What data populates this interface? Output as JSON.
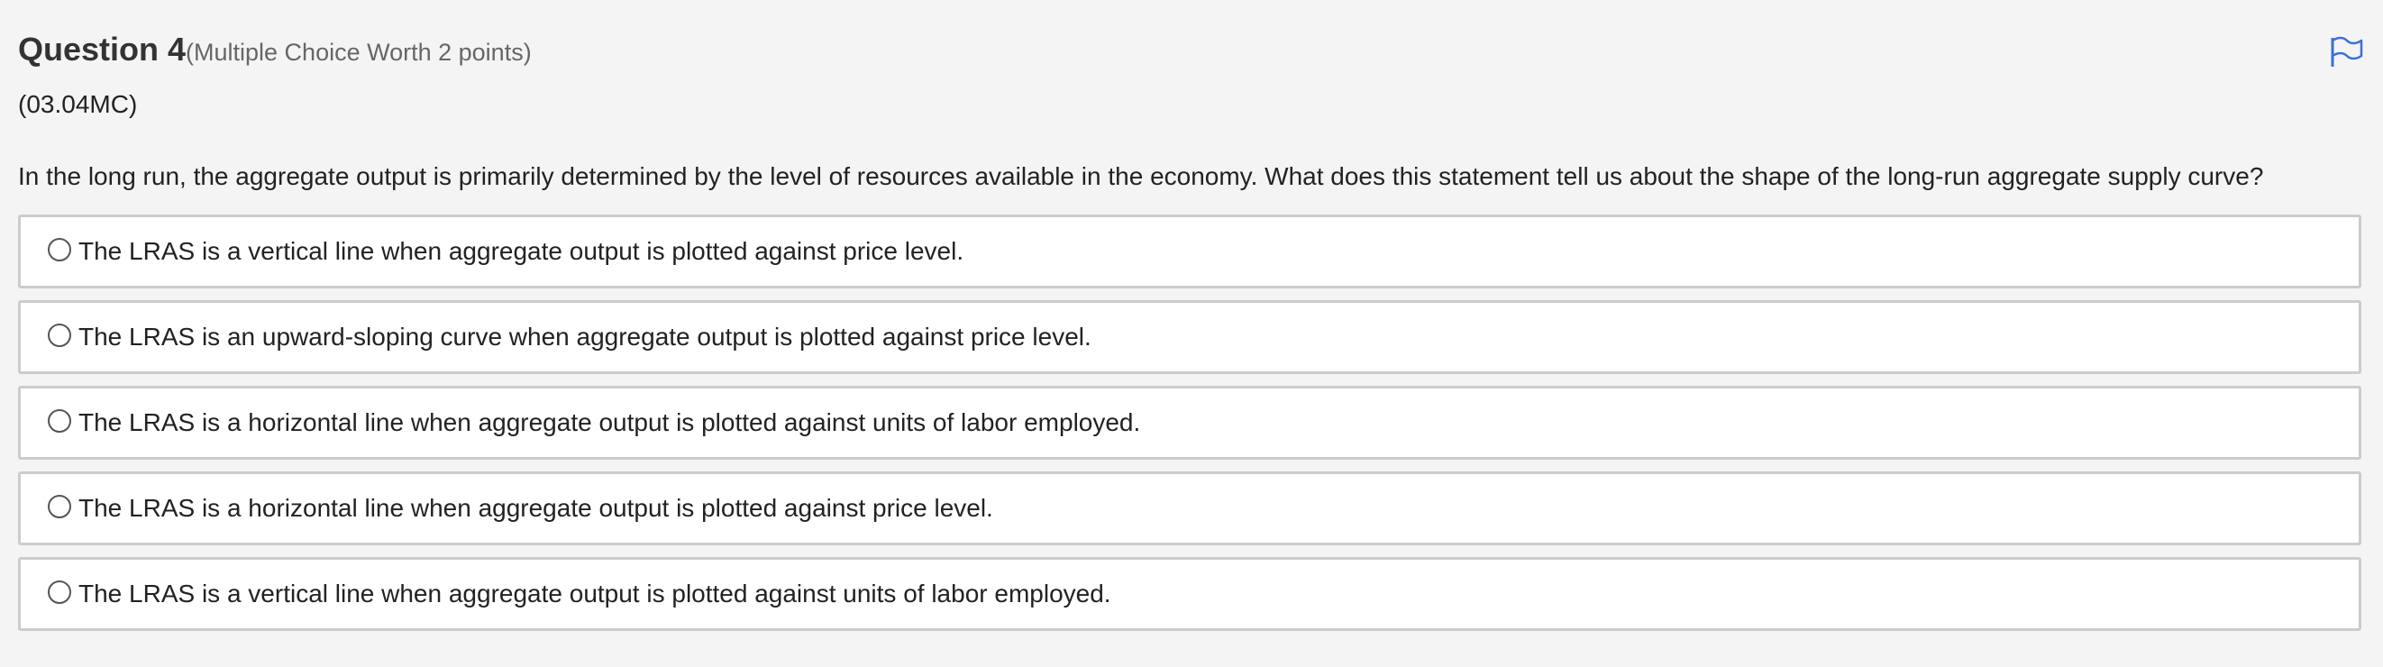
{
  "question": {
    "title": "Question 4",
    "worth": "(Multiple Choice Worth 2 points)",
    "code": "(03.04MC)",
    "stem": "In the long run, the aggregate output is primarily determined by the level of resources available in the economy. What does this statement tell us about the shape of the long-run aggregate supply curve?"
  },
  "flag_icon": "flag-icon",
  "accent_color": "#3a6fd8",
  "options": [
    {
      "text": "The LRAS is a vertical line when aggregate output is plotted against price level."
    },
    {
      "text": "The LRAS is an upward-sloping curve when aggregate output is plotted against price level."
    },
    {
      "text": "The LRAS is a horizontal line when aggregate output is plotted against units of labor employed."
    },
    {
      "text": "The LRAS is a horizontal line when aggregate output is plotted against price level."
    },
    {
      "text": "The LRAS is a vertical line when aggregate output is plotted against units of labor employed."
    }
  ]
}
